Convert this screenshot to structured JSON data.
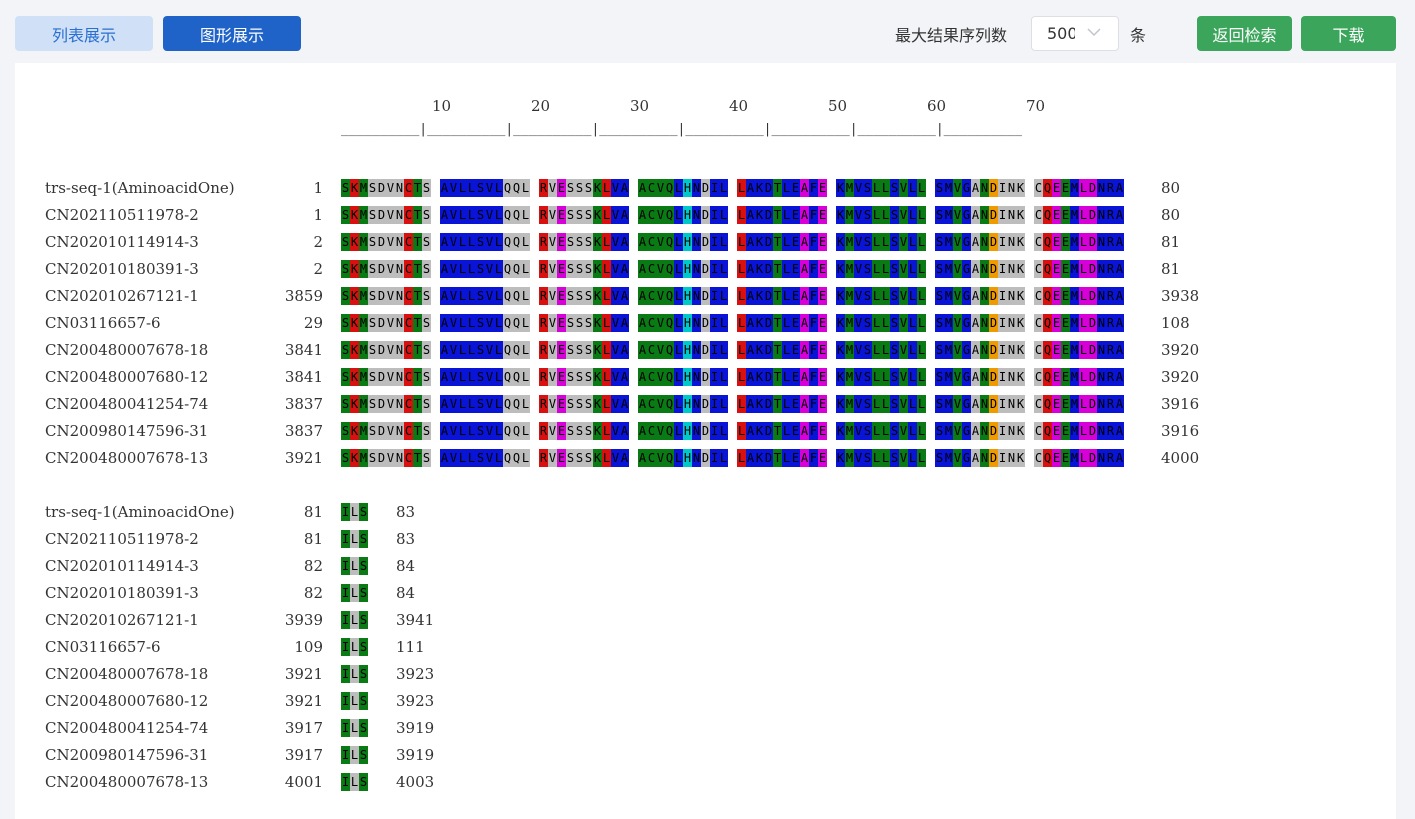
{
  "toolbar": {
    "list_view": "列表展示",
    "graph_view": "图形展示",
    "max_results_label": "最大结果序列数",
    "max_results_value": "500",
    "unit": "条",
    "back_to_search": "返回检索",
    "download": "下载"
  },
  "ruler": [
    "10",
    "20",
    "30",
    "40",
    "50",
    "60",
    "70"
  ],
  "colors": {
    "G": "#0a7a14",
    "B": "#0a14d6",
    "R": "#d81010",
    "Y": "#bdbdbd",
    "M": "#d800d8",
    "O": "#ee9a00",
    "C": "#00c8c8"
  },
  "block1": {
    "sequence": "SKMSDVNCTSAVLLSVLQQLRVESSSKLVAACVQLHNDILLAKDTLEAFEKMVSLLSVLLSMVGANDINKCQEEMLDNRA",
    "color_pattern": "GRGYYYYRGYBBBBBBBYYYRYMYYYGRBBGGGGBCBYBBRBBBGBBMBMBGBBGGBGBGBBGBYGOYYYYRMGBMMBBBGRY",
    "rows": [
      {
        "name": "trs-seq-1(AminoacidOne)",
        "start": "1",
        "end": "80"
      },
      {
        "name": "CN202110511978-2",
        "start": "1",
        "end": "80"
      },
      {
        "name": "CN202010114914-3",
        "start": "2",
        "end": "81"
      },
      {
        "name": "CN202010180391-3",
        "start": "2",
        "end": "81"
      },
      {
        "name": "CN202010267121-1",
        "start": "3859",
        "end": "3938"
      },
      {
        "name": "CN03116657-6",
        "start": "29",
        "end": "108"
      },
      {
        "name": "CN200480007678-18",
        "start": "3841",
        "end": "3920"
      },
      {
        "name": "CN200480007680-12",
        "start": "3841",
        "end": "3920"
      },
      {
        "name": "CN200480041254-74",
        "start": "3837",
        "end": "3916"
      },
      {
        "name": "CN200980147596-31",
        "start": "3837",
        "end": "3916"
      },
      {
        "name": "CN200480007678-13",
        "start": "3921",
        "end": "4000"
      }
    ]
  },
  "block2": {
    "sequence": "ILS",
    "color_pattern": "GYG",
    "rows": [
      {
        "name": "trs-seq-1(AminoacidOne)",
        "start": "81",
        "end": "83"
      },
      {
        "name": "CN202110511978-2",
        "start": "81",
        "end": "83"
      },
      {
        "name": "CN202010114914-3",
        "start": "82",
        "end": "84"
      },
      {
        "name": "CN202010180391-3",
        "start": "82",
        "end": "84"
      },
      {
        "name": "CN202010267121-1",
        "start": "3939",
        "end": "3941"
      },
      {
        "name": "CN03116657-6",
        "start": "109",
        "end": "111"
      },
      {
        "name": "CN200480007678-18",
        "start": "3921",
        "end": "3923"
      },
      {
        "name": "CN200480007680-12",
        "start": "3921",
        "end": "3923"
      },
      {
        "name": "CN200480041254-74",
        "start": "3917",
        "end": "3919"
      },
      {
        "name": "CN200980147596-31",
        "start": "3917",
        "end": "3919"
      },
      {
        "name": "CN200480007678-13",
        "start": "4001",
        "end": "4003"
      }
    ]
  }
}
